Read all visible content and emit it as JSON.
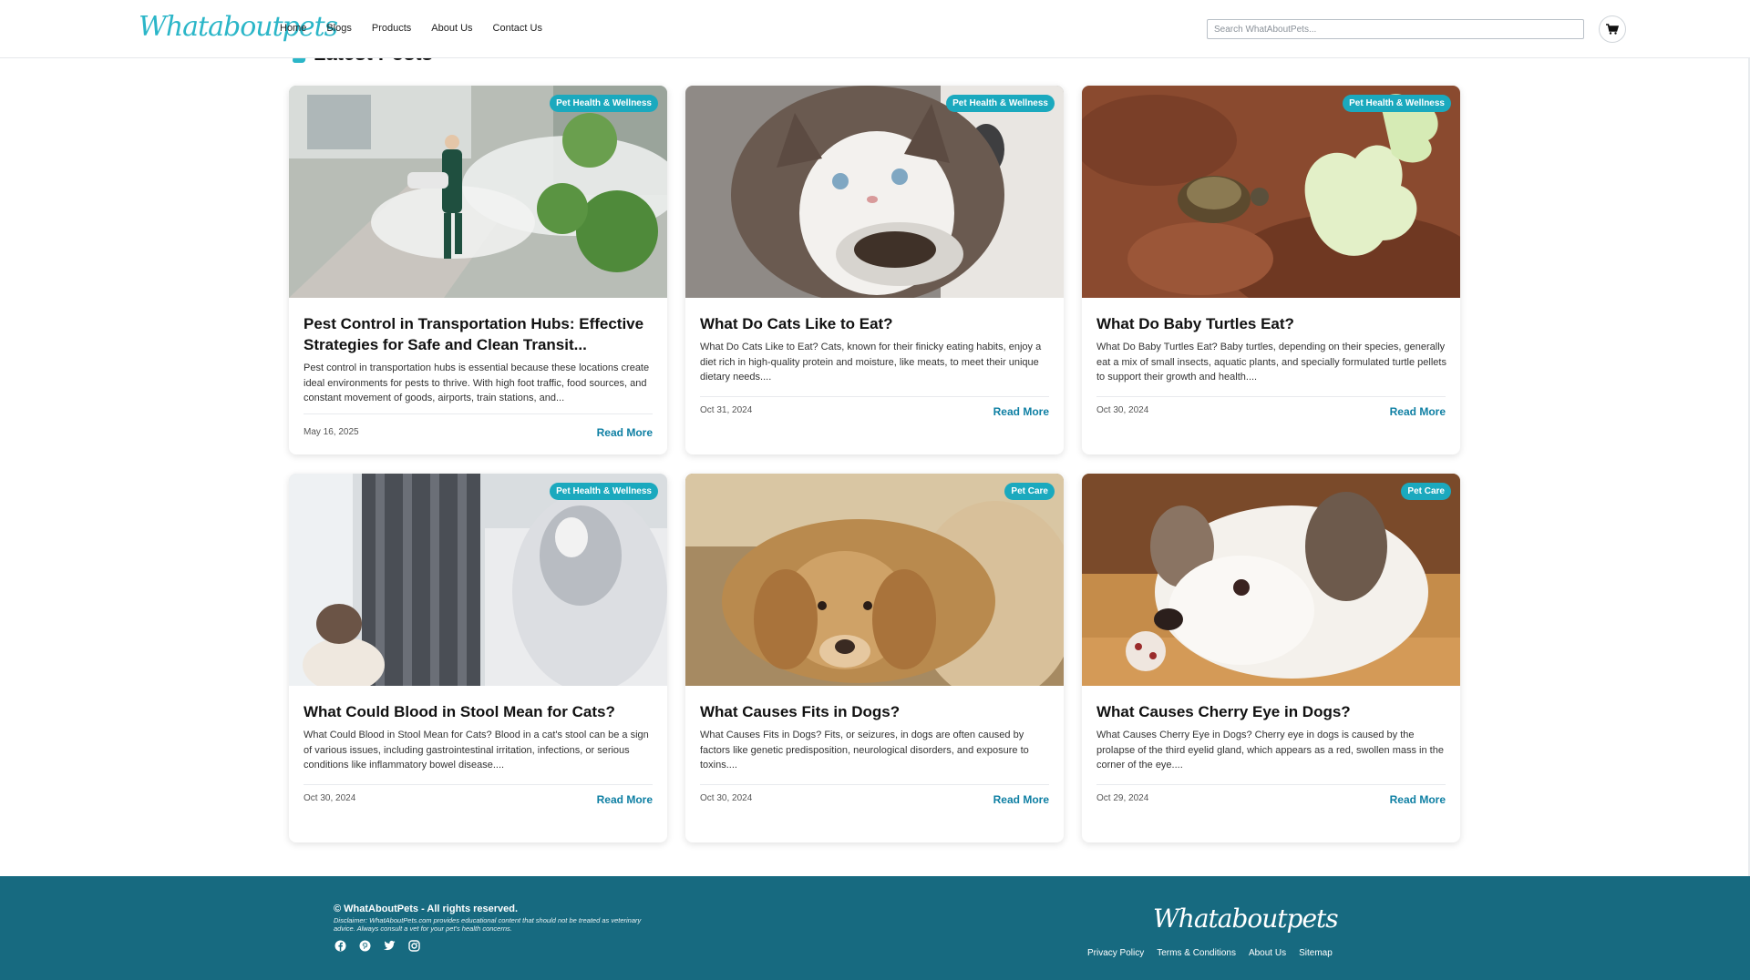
{
  "header": {
    "logo_text": "Whataboutpets",
    "nav": [
      "Home",
      "Blogs",
      "Products",
      "About Us",
      "Contact Us"
    ],
    "search_placeholder": "Search WhatAboutPets...",
    "cart_icon": "cart-icon"
  },
  "section": {
    "title": "Latest Posts"
  },
  "posts": [
    {
      "badge": "Pet Health & Wellness",
      "title": "Pest Control in Transportation Hubs: Effective Strategies for Safe and Clean Transit...",
      "excerpt": "Pest control in transportation hubs is essential because these locations create ideal environments for pests to thrive. With high foot traffic, food sources, and constant movement of goods, airports, train stations, and...",
      "date": "May 16, 2025",
      "read_more": "Read More"
    },
    {
      "badge": "Pet Health & Wellness",
      "title": "What Do Cats Like to Eat?",
      "excerpt": "What Do Cats Like to Eat? Cats, known for their finicky eating habits, enjoy a diet rich in high-quality protein and moisture, like meats, to meet their unique dietary needs....",
      "date": "Oct 31, 2024",
      "read_more": "Read More"
    },
    {
      "badge": "Pet Health & Wellness",
      "title": "What Do Baby Turtles Eat?",
      "excerpt": "What Do Baby Turtles Eat? Baby turtles, depending on their species, generally eat a mix of small insects, aquatic plants, and specially formulated turtle pellets to support their growth and health....",
      "date": "Oct 30, 2024",
      "read_more": "Read More"
    },
    {
      "badge": "Pet Health & Wellness",
      "title": "What Could Blood in Stool Mean for Cats?",
      "excerpt": "What Could Blood in Stool Mean for Cats? Blood in a cat's stool can be a sign of various issues, including gastrointestinal irritation, infections, or serious conditions like inflammatory bowel disease....",
      "date": "Oct 30, 2024",
      "read_more": "Read More"
    },
    {
      "badge": "Pet Care",
      "title": "What Causes Fits in Dogs?",
      "excerpt": "What Causes Fits in Dogs? Fits, or seizures, in dogs are often caused by factors like genetic predisposition, neurological disorders, and exposure to toxins....",
      "date": "Oct 30, 2024",
      "read_more": "Read More"
    },
    {
      "badge": "Pet Care",
      "title": "What Causes Cherry Eye in Dogs?",
      "excerpt": "What Causes Cherry Eye in Dogs? Cherry eye in dogs is caused by the prolapse of the third eyelid gland, which appears as a red, swollen mass in the corner of the eye....",
      "date": "Oct 29, 2024",
      "read_more": "Read More"
    }
  ],
  "footer": {
    "copyright": "© WhatAboutPets - All rights reserved.",
    "disclaimer": "Disclaimer: WhatAboutPets.com provides educational content that should not be treated as veterinary advice. Always consult a vet for your pet's health concerns.",
    "social": [
      "facebook-icon",
      "pinterest-icon",
      "twitter-icon",
      "instagram-icon"
    ],
    "logo_text": "Whataboutpets",
    "links": [
      "Privacy Policy",
      "Terms & Conditions",
      "About Us",
      "Sitemap"
    ]
  },
  "colors": {
    "accent": "#2bb6c8",
    "badge": "#1ba9be",
    "link": "#0e7fa3",
    "footer_bg": "#176a80"
  }
}
